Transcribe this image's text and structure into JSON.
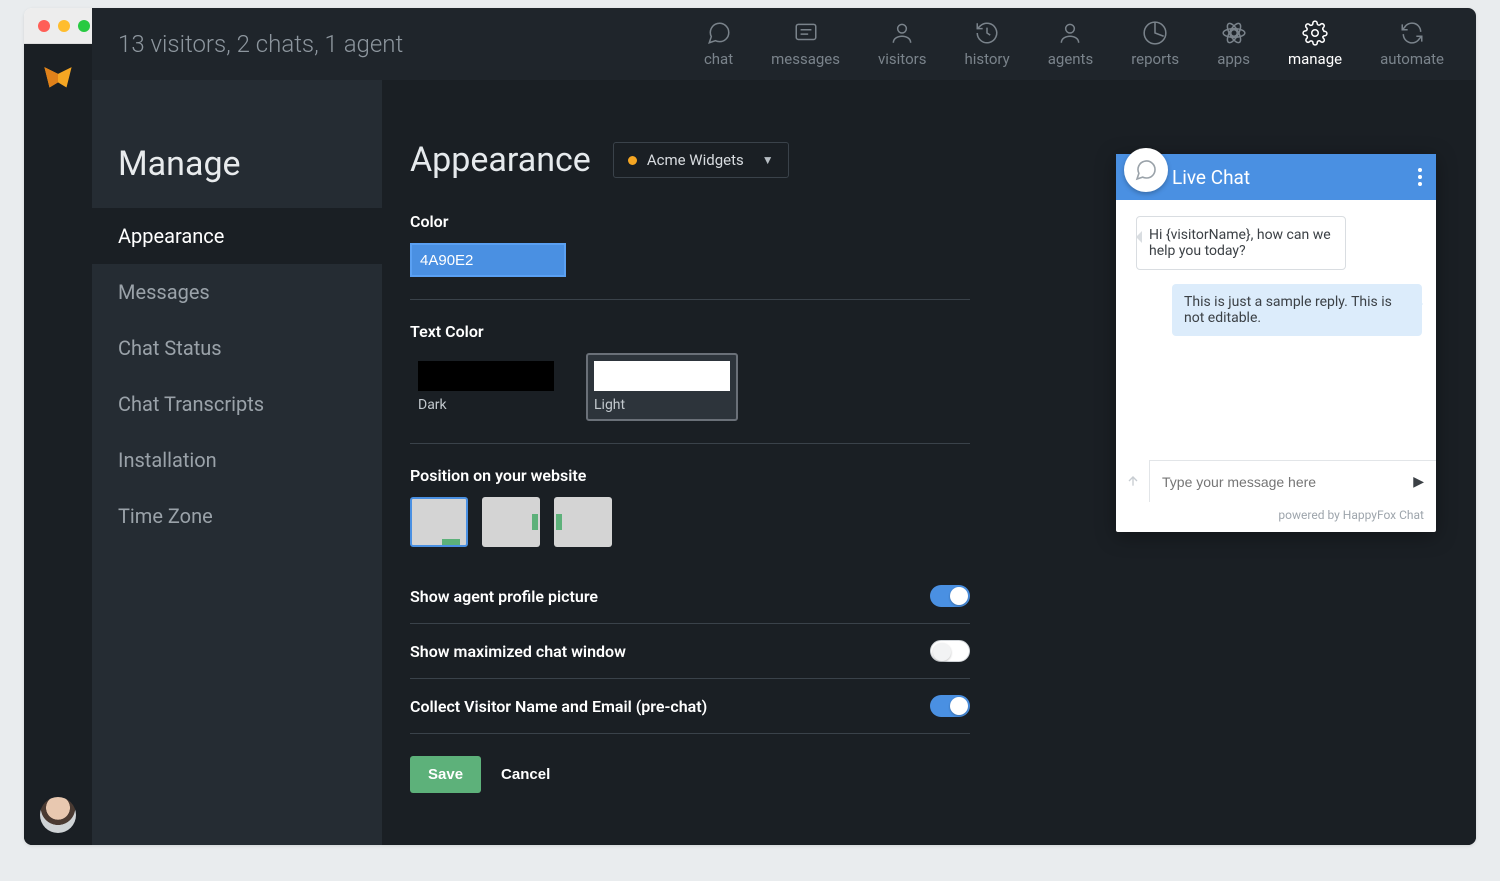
{
  "topbar": {
    "status": "13 visitors, 2 chats, 1 agent",
    "nav": [
      {
        "label": "chat",
        "icon": "chat"
      },
      {
        "label": "messages",
        "icon": "messages"
      },
      {
        "label": "visitors",
        "icon": "visitors"
      },
      {
        "label": "history",
        "icon": "history"
      },
      {
        "label": "agents",
        "icon": "agents"
      },
      {
        "label": "reports",
        "icon": "reports"
      },
      {
        "label": "apps",
        "icon": "apps"
      },
      {
        "label": "manage",
        "icon": "manage",
        "active": true
      },
      {
        "label": "automate",
        "icon": "automate"
      }
    ]
  },
  "sidebar": {
    "heading": "Manage",
    "items": [
      {
        "label": "Appearance",
        "active": true
      },
      {
        "label": "Messages"
      },
      {
        "label": "Chat Status"
      },
      {
        "label": "Chat Transcripts"
      },
      {
        "label": "Installation"
      },
      {
        "label": "Time Zone"
      }
    ]
  },
  "page": {
    "title": "Appearance",
    "profile": "Acme Widgets"
  },
  "form": {
    "color_label": "Color",
    "color_value": "4A90E2",
    "text_color_label": "Text Color",
    "dark_label": "Dark",
    "light_label": "Light",
    "text_color_selected": "light",
    "position_label": "Position on your website",
    "position_selected": "bottom-right",
    "toggles": [
      {
        "label": "Show agent profile picture",
        "on": true
      },
      {
        "label": "Show maximized chat window",
        "on": false
      },
      {
        "label": "Collect Visitor Name and Email (pre-chat)",
        "on": true
      }
    ],
    "save_label": "Save",
    "cancel_label": "Cancel"
  },
  "chat": {
    "title": "Live Chat",
    "greeting": "Hi {visitorName}, how can we help you today?",
    "reply": "This is just a sample reply. This is not editable.",
    "placeholder": "Type your message here",
    "footer": "powered by HappyFox Chat"
  },
  "colors": {
    "accent": "#4a90e2",
    "save_btn": "#5db17a"
  }
}
